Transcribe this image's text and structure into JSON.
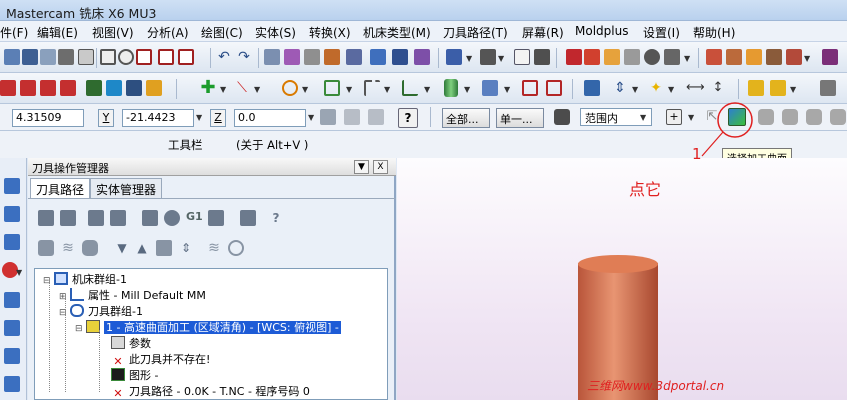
{
  "title": "Mastercam 铣床 X6 MU3",
  "menu": [
    "件(F)",
    "编辑(E)",
    "视图(V)",
    "分析(A)",
    "绘图(C)",
    "实体(S)",
    "转换(X)",
    "机床类型(M)",
    "刀具路径(T)",
    "屏幕(R)",
    "Moldplus",
    "设置(I)",
    "帮助(H)"
  ],
  "coords": {
    "x_value": "4.31509",
    "y_label": "Y",
    "y_value": "-21.4423",
    "z_label": "Z",
    "z_value": "0.0"
  },
  "selection": {
    "all_button": "全部...",
    "single_button": "单一...",
    "range_value": "范围内"
  },
  "toolbar_caption": {
    "title": "工具栏",
    "about": "(关于 Alt+V )"
  },
  "tooltip": "选择加工曲面",
  "annotation": {
    "number": "1",
    "hint": "点它"
  },
  "panel": {
    "title": "刀具操作管理器",
    "close": "X",
    "tabs": [
      "刀具路径",
      "实体管理器"
    ],
    "mini_text": "G1"
  },
  "tree": [
    {
      "label": "机床群组-1"
    },
    {
      "label": "属性 - Mill Default MM"
    },
    {
      "label": "刀具群组-1"
    },
    {
      "label": "1 - 高速曲面加工 (区域清角) - [WCS: 俯视图] -"
    },
    {
      "label": "参数"
    },
    {
      "label": "此刀具并不存在!"
    },
    {
      "label": "图形 -"
    },
    {
      "label": "刀具路径 - 0.0K - T.NC - 程序号码 0"
    }
  ],
  "watermark": "三维网www.3dportal.cn",
  "colors": {
    "accent": "#e02020",
    "cylinder": "#d9794f",
    "selection": "#1d5bd6"
  }
}
